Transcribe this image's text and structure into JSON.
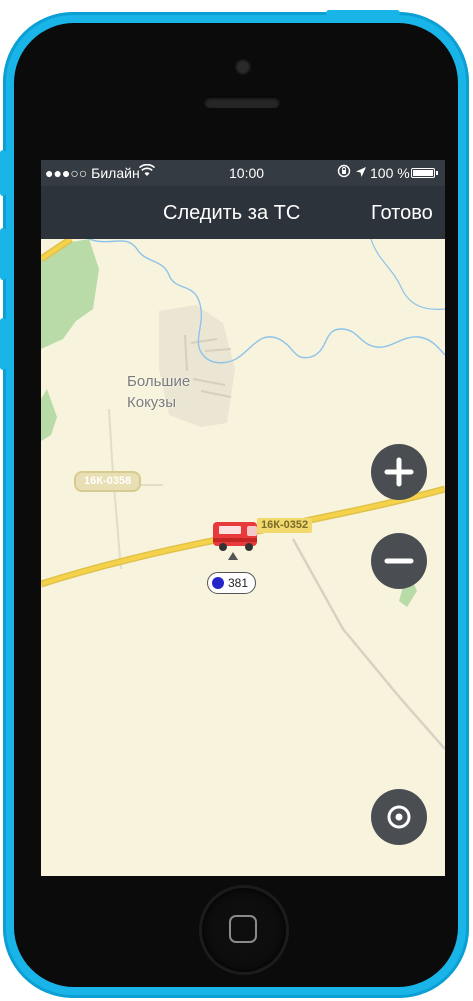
{
  "status_bar": {
    "carrier": "●●●○○ Билайн",
    "time": "10:00",
    "battery": "100 %",
    "battery_level": 1.0
  },
  "nav": {
    "title": "Следить за ТС",
    "done_label": "Готово"
  },
  "map": {
    "place_label": "Большие\nКокузы",
    "road_labels": [
      "16К-0358",
      "16К-0352"
    ],
    "vehicle_label": "381",
    "vehicle_color": "#2424c8"
  },
  "controls": {
    "zoom_in": "plus-icon",
    "zoom_out": "minus-icon",
    "locate": "locate-icon"
  },
  "colors": {
    "phone": "#1ab5e8",
    "nav_bar": "#2d333b",
    "map_background": "#f8f3dc",
    "road": "#f5d24a",
    "water": "#8cc3ea",
    "forest": "#b8dba7"
  }
}
